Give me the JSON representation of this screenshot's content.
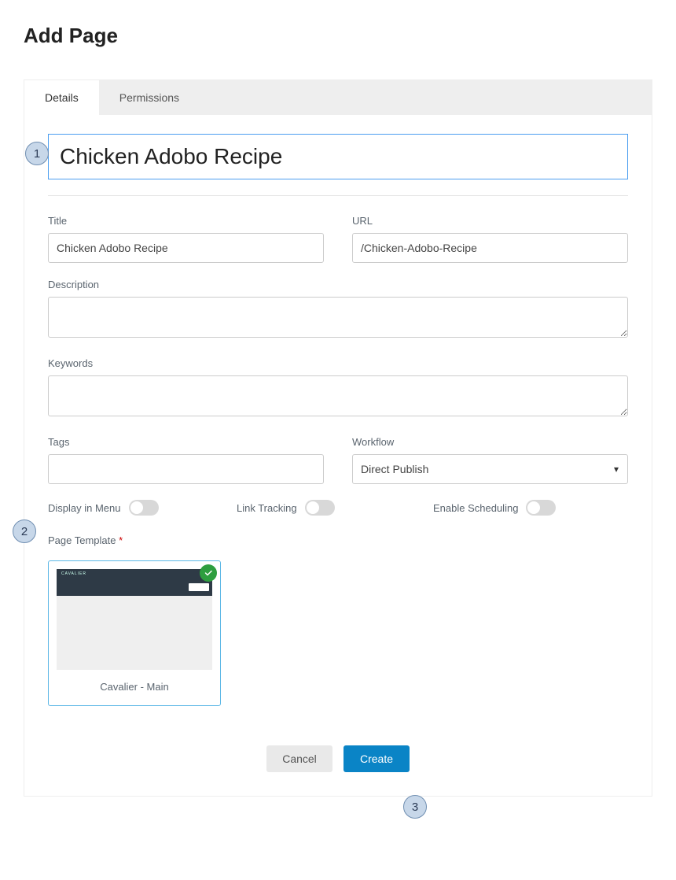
{
  "header": {
    "title": "Add Page"
  },
  "tabs": {
    "details": "Details",
    "permissions": "Permissions"
  },
  "form": {
    "big_title_value": "Chicken Adobo Recipe",
    "title_label": "Title",
    "title_value": "Chicken Adobo Recipe",
    "url_label": "URL",
    "url_value": "/Chicken-Adobo-Recipe",
    "description_label": "Description",
    "description_value": "",
    "keywords_label": "Keywords",
    "keywords_value": "",
    "tags_label": "Tags",
    "tags_value": "",
    "workflow_label": "Workflow",
    "workflow_value": "Direct Publish",
    "display_in_menu_label": "Display in Menu",
    "link_tracking_label": "Link Tracking",
    "enable_scheduling_label": "Enable Scheduling",
    "page_template_label": "Page Template"
  },
  "template": {
    "name": "Cavalier - Main",
    "brand": "CAVALIER"
  },
  "actions": {
    "cancel": "Cancel",
    "create": "Create"
  },
  "callouts": {
    "one": "1",
    "two": "2",
    "three": "3"
  }
}
